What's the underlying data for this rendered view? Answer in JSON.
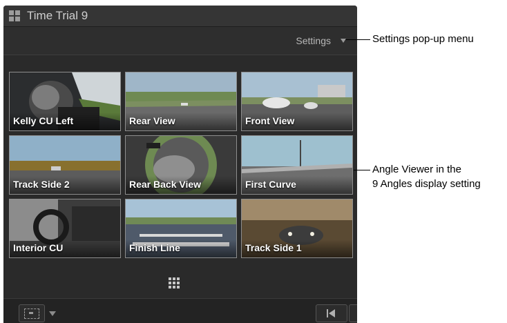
{
  "window": {
    "title": "Time Trial 9",
    "icon": "angle-grid-icon"
  },
  "settings": {
    "label": "Settings",
    "icon": "chevron-down-icon"
  },
  "angles": [
    {
      "label": "Kelly CU Left"
    },
    {
      "label": "Rear View"
    },
    {
      "label": "Front View"
    },
    {
      "label": "Track Side 2"
    },
    {
      "label": "Rear Back View"
    },
    {
      "label": "First Curve"
    },
    {
      "label": "Interior CU"
    },
    {
      "label": "Finish Line"
    },
    {
      "label": "Track Side 1"
    }
  ],
  "display_setting_icon": "nine-angles-icon",
  "bottom": {
    "viewer_button_icon": "viewer-display-icon",
    "prev_button_icon": "go-to-start-icon"
  },
  "callouts": {
    "settings": "Settings pop-up menu",
    "viewer_line1": "Angle Viewer in the",
    "viewer_line2": "9 Angles display setting"
  }
}
